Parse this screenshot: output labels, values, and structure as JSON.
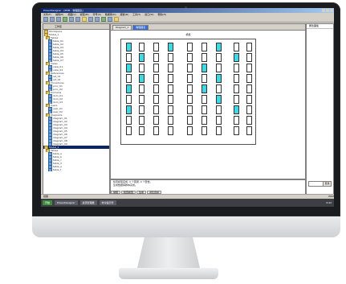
{
  "window": {
    "title": "PowerDesigner - [PDM - 物理图表]"
  },
  "menu": [
    "文件(F)",
    "编辑(E)",
    "视图(V)",
    "模型(M)",
    "符号(S)",
    "数据库(D)",
    "报告(R)",
    "工具(T)",
    "窗口(W)",
    "帮助(H)"
  ],
  "left_panel": {
    "title": "工作区",
    "items": [
      {
        "label": "Workspace",
        "icon": "folder"
      },
      {
        "label": "Model_1",
        "icon": "folder"
      },
      {
        "label": "Tables",
        "icon": "folder"
      },
      {
        "label": "table_01",
        "icon": "db"
      },
      {
        "label": "table_02",
        "icon": "db"
      },
      {
        "label": "table_03",
        "icon": "db"
      },
      {
        "label": "table_04",
        "icon": "db"
      },
      {
        "label": "table_05",
        "icon": "db"
      },
      {
        "label": "table_06",
        "icon": "db"
      },
      {
        "label": "table_07",
        "icon": "db"
      },
      {
        "label": "Views",
        "icon": "folder"
      },
      {
        "label": "view_01",
        "icon": "db"
      },
      {
        "label": "view_02",
        "icon": "db"
      },
      {
        "label": "References",
        "icon": "folder"
      },
      {
        "label": "ref_01",
        "icon": "db"
      },
      {
        "label": "ref_02",
        "icon": "db"
      },
      {
        "label": "Procedures",
        "icon": "folder"
      },
      {
        "label": "proc_01",
        "icon": "db"
      },
      {
        "label": "proc_02",
        "icon": "db"
      },
      {
        "label": "Domains",
        "icon": "folder"
      },
      {
        "label": "dom_01",
        "icon": "db"
      },
      {
        "label": "dom_02",
        "icon": "db"
      },
      {
        "label": "dom_03",
        "icon": "db"
      },
      {
        "label": "Users",
        "icon": "folder"
      },
      {
        "label": "user_01",
        "icon": "db"
      },
      {
        "label": "user_02",
        "icon": "db"
      },
      {
        "label": "Diagrams",
        "icon": "folder"
      },
      {
        "label": "diagram_01",
        "icon": "db"
      },
      {
        "label": "diagram_02",
        "icon": "db"
      },
      {
        "label": "diagram_03",
        "icon": "db"
      },
      {
        "label": "diagram_04",
        "icon": "db"
      },
      {
        "label": "diagram_05",
        "icon": "db"
      },
      {
        "label": "diagram_06",
        "icon": "db"
      },
      {
        "label": "diagram_07",
        "icon": "db"
      },
      {
        "label": "diagram_08",
        "icon": "db"
      },
      {
        "label": "diagram_09",
        "icon": "db"
      },
      {
        "label": "Model_2",
        "icon": "folder",
        "selected": true
      },
      {
        "label": "Tables",
        "icon": "folder"
      },
      {
        "label": "table_a",
        "icon": "db"
      },
      {
        "label": "table_b",
        "icon": "db"
      },
      {
        "label": "table_c",
        "icon": "db"
      },
      {
        "label": "table_d",
        "icon": "db"
      },
      {
        "label": "table_e",
        "icon": "db"
      },
      {
        "label": "table_f",
        "icon": "db"
      }
    ]
  },
  "doc_tabs": [
    "Diagram_1",
    "物理图表"
  ],
  "diagram": {
    "title": "机柜"
  },
  "right_panel": {
    "title": "属性面板",
    "button": "查找"
  },
  "output": {
    "lines": [
      "检查模型完成: 0 个错误, 0 个警告。",
      "生成数据库脚本完成。"
    ],
    "tabs": [
      "常规",
      "检查模型",
      "生成",
      "对比合并"
    ]
  },
  "status": {
    "left": "就绪",
    "right": "PDM"
  },
  "taskbar": {
    "start": "开始",
    "tasks": [
      "PowerDesigner",
      "资源管理器",
      "命令提示符"
    ],
    "clock": "9:42"
  }
}
